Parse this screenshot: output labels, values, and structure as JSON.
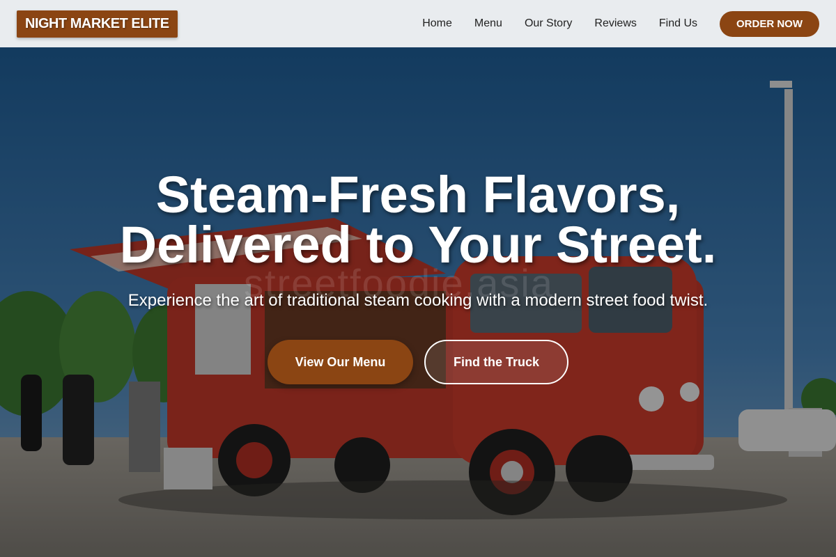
{
  "header": {
    "logo": "NIGHT MARKET ELITE",
    "nav": [
      "Home",
      "Menu",
      "Our Story",
      "Reviews",
      "Find Us"
    ],
    "order_label": "ORDER NOW"
  },
  "hero": {
    "title_line1": "Steam-Fresh Flavors,",
    "title_line2": "Delivered to Your Street.",
    "subtitle": "Experience the art of traditional steam cooking with a modern street food twist.",
    "menu_button": "View Our Menu",
    "truck_button": "Find the Truck",
    "watermark": "streetfoodie.asia"
  },
  "colors": {
    "brand": "#8b4513",
    "header_bg": "#e9ecef"
  }
}
